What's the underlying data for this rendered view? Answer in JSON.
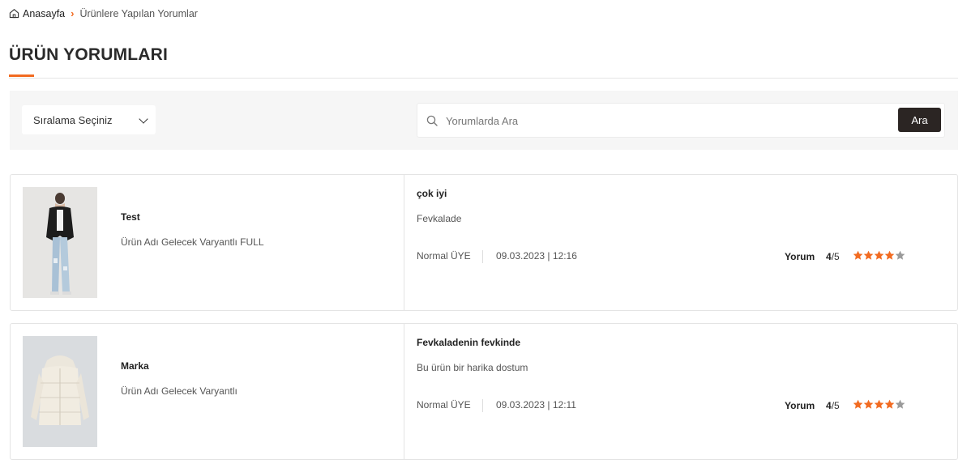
{
  "breadcrumb": {
    "home": "Anasayfa",
    "separator": "›",
    "current": "Ürünlere Yapılan Yorumlar"
  },
  "page": {
    "title": "ÜRÜN YORUMLARI"
  },
  "filters": {
    "sort_label": "Sıralama Seçiniz",
    "search_placeholder": "Yorumlarda Ara",
    "search_value": "",
    "search_button": "Ara"
  },
  "colors": {
    "accent": "#f26b21",
    "star_filled": "#f26b21",
    "star_empty": "#9a9a9a",
    "button_dark": "#2b2523"
  },
  "reviews": [
    {
      "brand": "Test",
      "product_name": "Ürün Adı Gelecek Varyantlı FULL",
      "image_alt": "woman-in-black-jacket-and-ripped-jeans",
      "title": "çok iyi",
      "body": "Fevkalade",
      "member_type": "Normal ÜYE",
      "date": "09.03.2023 | 12:16",
      "rating_label": "Yorum",
      "rating_value": "4",
      "rating_max": "/5",
      "stars": 4
    },
    {
      "brand": "Marka",
      "product_name": "Ürün Adı Gelecek Varyantlı",
      "image_alt": "white-puffer-jacket",
      "title": "Fevkaladenin fevkinde",
      "body": "Bu ürün bir harika dostum",
      "member_type": "Normal ÜYE",
      "date": "09.03.2023 | 12:11",
      "rating_label": "Yorum",
      "rating_value": "4",
      "rating_max": "/5",
      "stars": 4
    }
  ]
}
